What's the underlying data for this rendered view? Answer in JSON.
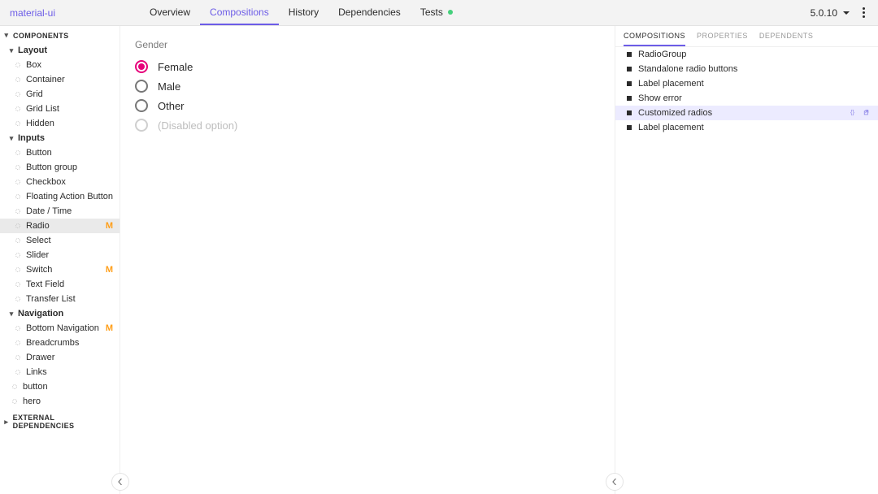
{
  "brand": "material-ui",
  "version": "5.0.10",
  "tabs": [
    {
      "id": "overview",
      "label": "Overview"
    },
    {
      "id": "compositions",
      "label": "Compositions",
      "active": true
    },
    {
      "id": "history",
      "label": "History"
    },
    {
      "id": "dependencies",
      "label": "Dependencies"
    },
    {
      "id": "tests",
      "label": "Tests",
      "dot": "#44d07b"
    }
  ],
  "left_tree": {
    "sections": [
      {
        "id": "components",
        "label": "COMPONENTS",
        "open": true,
        "groups": [
          {
            "id": "layout",
            "label": "Layout",
            "open": true,
            "items": [
              {
                "label": "Box"
              },
              {
                "label": "Container"
              },
              {
                "label": "Grid"
              },
              {
                "label": "Grid List"
              },
              {
                "label": "Hidden"
              }
            ]
          },
          {
            "id": "inputs",
            "label": "Inputs",
            "open": true,
            "items": [
              {
                "label": "Button"
              },
              {
                "label": "Button group"
              },
              {
                "label": "Checkbox"
              },
              {
                "label": "Floating Action Button"
              },
              {
                "label": "Date / Time"
              },
              {
                "label": "Radio",
                "badge": "M",
                "selected": true
              },
              {
                "label": "Select"
              },
              {
                "label": "Slider"
              },
              {
                "label": "Switch",
                "badge": "M"
              },
              {
                "label": "Text Field"
              },
              {
                "label": "Transfer List"
              }
            ]
          },
          {
            "id": "navigation",
            "label": "Navigation",
            "open": true,
            "items": [
              {
                "label": "Bottom Navigation",
                "badge": "M"
              },
              {
                "label": "Breadcrumbs"
              },
              {
                "label": "Drawer"
              },
              {
                "label": "Links"
              }
            ]
          }
        ],
        "loose_items": [
          {
            "label": "button"
          },
          {
            "label": "hero"
          }
        ]
      },
      {
        "id": "external-deps",
        "label": "EXTERNAL DEPENDENCIES",
        "open": false
      }
    ]
  },
  "canvas": {
    "group_label": "Gender",
    "options": [
      {
        "id": "female",
        "label": "Female",
        "checked": true
      },
      {
        "id": "male",
        "label": "Male"
      },
      {
        "id": "other",
        "label": "Other"
      },
      {
        "id": "disabled",
        "label": "(Disabled option)",
        "disabled": true
      }
    ]
  },
  "right_panel": {
    "tabs": [
      {
        "id": "compositions",
        "label": "COMPOSITIONS",
        "active": true
      },
      {
        "id": "properties",
        "label": "PROPERTIES"
      },
      {
        "id": "dependents",
        "label": "DEPENDENTS"
      }
    ],
    "items": [
      {
        "label": "RadioGroup"
      },
      {
        "label": "Standalone radio buttons"
      },
      {
        "label": "Label placement"
      },
      {
        "label": "Show error"
      },
      {
        "label": "Customized radios",
        "selected": true,
        "actions": true
      },
      {
        "label": "Label placement"
      }
    ]
  }
}
